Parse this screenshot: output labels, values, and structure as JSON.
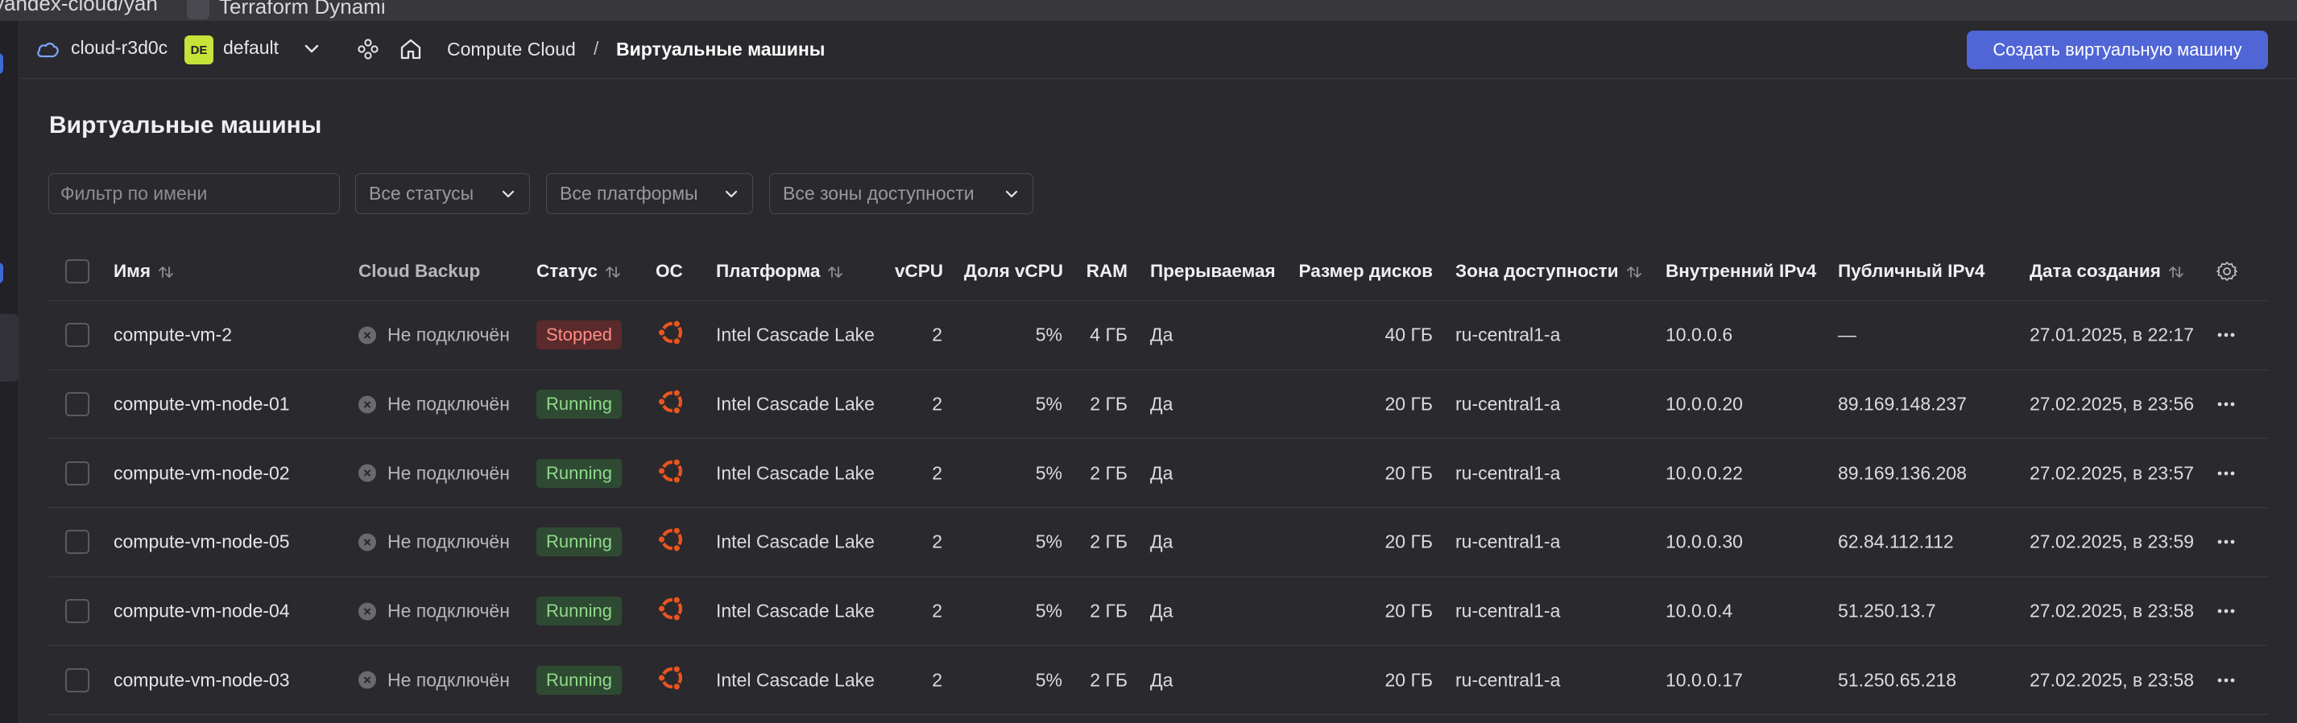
{
  "browser": {
    "bookmark_1": "yandex-cloud/yan",
    "bookmark_2": "Terraform Dynami"
  },
  "header": {
    "cloud_name": "cloud-r3d0c",
    "folder_badge": "DE",
    "folder_name": "default",
    "breadcrumb": [
      "Compute Cloud",
      "/",
      "Виртуальные машины"
    ],
    "create_button": "Создать виртуальную машину"
  },
  "page": {
    "title": "Виртуальные машины"
  },
  "filters": {
    "name_placeholder": "Фильтр по имени",
    "status": "Все статусы",
    "platform": "Все платформы",
    "zone": "Все зоны доступности"
  },
  "table": {
    "columns": {
      "name": "Имя",
      "backup": "Cloud Backup",
      "status": "Статус",
      "os": "ОС",
      "platform": "Платформа",
      "vcpu": "vCPU",
      "vcpu_share": "Доля vCPU",
      "ram": "RAM",
      "preemptible": "Прерываемая",
      "disk_size": "Размер дисков",
      "zone": "Зона доступности",
      "ipv4_internal": "Внутренний IPv4",
      "ipv4_public": "Публичный IPv4",
      "created": "Дата создания"
    },
    "rows": [
      {
        "name": "compute-vm-2",
        "backup": "Не подключён",
        "status": "Stopped",
        "os": "ubuntu",
        "platform": "Intel Cascade Lake",
        "vcpu": "2",
        "vcpu_share": "5%",
        "ram": "4 ГБ",
        "preemptible": "Да",
        "disk": "40 ГБ",
        "zone": "ru-central1-a",
        "ipv4": "10.0.0.6",
        "public_ip": "—",
        "created": "27.01.2025, в 22:17"
      },
      {
        "name": "compute-vm-node-01",
        "backup": "Не подключён",
        "status": "Running",
        "os": "ubuntu",
        "platform": "Intel Cascade Lake",
        "vcpu": "2",
        "vcpu_share": "5%",
        "ram": "2 ГБ",
        "preemptible": "Да",
        "disk": "20 ГБ",
        "zone": "ru-central1-a",
        "ipv4": "10.0.0.20",
        "public_ip": "89.169.148.237",
        "created": "27.02.2025, в 23:56"
      },
      {
        "name": "compute-vm-node-02",
        "backup": "Не подключён",
        "status": "Running",
        "os": "ubuntu",
        "platform": "Intel Cascade Lake",
        "vcpu": "2",
        "vcpu_share": "5%",
        "ram": "2 ГБ",
        "preemptible": "Да",
        "disk": "20 ГБ",
        "zone": "ru-central1-a",
        "ipv4": "10.0.0.22",
        "public_ip": "89.169.136.208",
        "created": "27.02.2025, в 23:57"
      },
      {
        "name": "compute-vm-node-05",
        "backup": "Не подключён",
        "status": "Running",
        "os": "ubuntu",
        "platform": "Intel Cascade Lake",
        "vcpu": "2",
        "vcpu_share": "5%",
        "ram": "2 ГБ",
        "preemptible": "Да",
        "disk": "20 ГБ",
        "zone": "ru-central1-a",
        "ipv4": "10.0.0.30",
        "public_ip": "62.84.112.112",
        "created": "27.02.2025, в 23:59"
      },
      {
        "name": "compute-vm-node-04",
        "backup": "Не подключён",
        "status": "Running",
        "os": "ubuntu",
        "platform": "Intel Cascade Lake",
        "vcpu": "2",
        "vcpu_share": "5%",
        "ram": "2 ГБ",
        "preemptible": "Да",
        "disk": "20 ГБ",
        "zone": "ru-central1-a",
        "ipv4": "10.0.0.4",
        "public_ip": "51.250.13.7",
        "created": "27.02.2025, в 23:58"
      },
      {
        "name": "compute-vm-node-03",
        "backup": "Не подключён",
        "status": "Running",
        "os": "ubuntu",
        "platform": "Intel Cascade Lake",
        "vcpu": "2",
        "vcpu_share": "5%",
        "ram": "2 ГБ",
        "preemptible": "Да",
        "disk": "20 ГБ",
        "zone": "ru-central1-a",
        "ipv4": "10.0.0.17",
        "public_ip": "51.250.65.218",
        "created": "27.02.2025, в 23:58"
      }
    ]
  },
  "colors": {
    "background": "#2a292d",
    "accent": "#5065d6",
    "running_bg": "#2f4a33",
    "running_text": "#8fd98a",
    "stopped_bg": "#5b2a2c",
    "stopped_text": "#ff8d84",
    "ubuntu_orange": "#e95420",
    "folder_badge": "#c6e33a"
  }
}
